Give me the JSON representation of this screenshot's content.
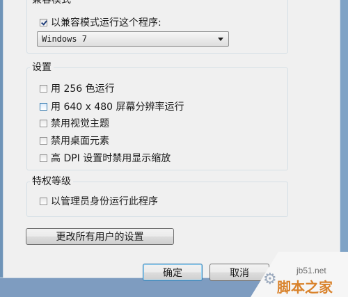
{
  "compat_group": {
    "title": "兼容模式",
    "checkbox_label": "以兼容模式运行这个程序:",
    "checked": true,
    "os_select_value": "Windows 7"
  },
  "settings_group": {
    "title": "设置",
    "items": [
      {
        "label": "用 256 色运行",
        "checked": false
      },
      {
        "label": "用 640 x 480 屏幕分辨率运行",
        "checked": false
      },
      {
        "label": "禁用视觉主题",
        "checked": false
      },
      {
        "label": "禁用桌面元素",
        "checked": false
      },
      {
        "label": "高 DPI 设置时禁用显示缩放",
        "checked": false
      }
    ]
  },
  "privilege_group": {
    "title": "特权等级",
    "checkbox_label": "以管理员身份运行此程序",
    "checked": false
  },
  "change_all_users_button": "更改所有用户的设置",
  "footer": {
    "ok_label": "确定",
    "cancel_label": "取消"
  },
  "watermark": {
    "url": "jb51.net",
    "brand": "脚本之家"
  }
}
